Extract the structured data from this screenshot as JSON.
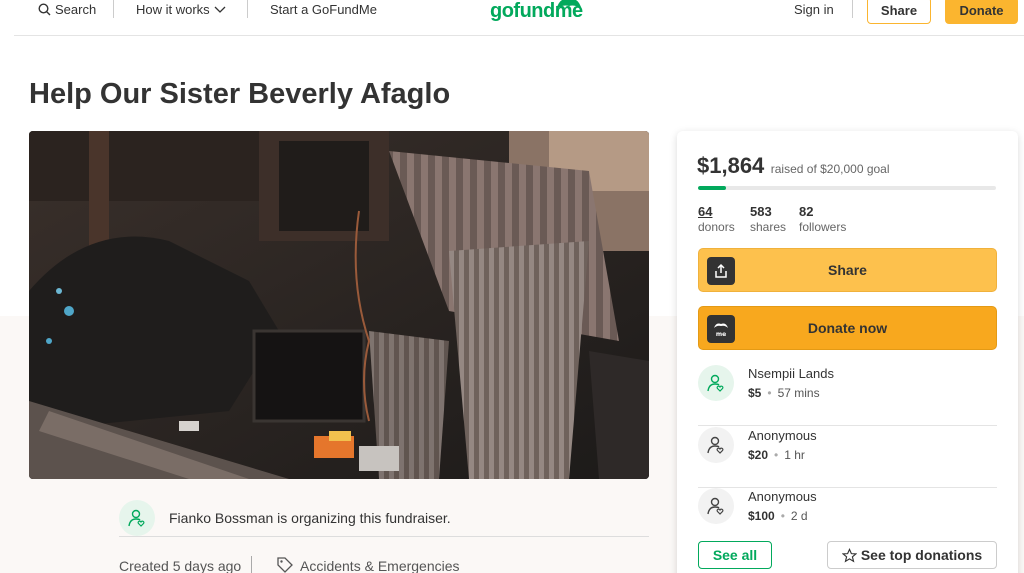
{
  "header": {
    "search_label": "Search",
    "how_it_works_label": "How it works",
    "start_label": "Start a GoFundMe",
    "logo_text": "gofundme",
    "sign_in_label": "Sign in",
    "share_label": "Share",
    "donate_label": "Donate"
  },
  "campaign": {
    "title": "Help Our Sister Beverly Afaglo",
    "organizer_text": "Fianko Bossman is organizing this fundraiser.",
    "created_text": "Created 5 days ago",
    "category": "Accidents & Emergencies"
  },
  "sidebar": {
    "raised_amount": "$1,864",
    "raised_goal_text": "raised of $20,000 goal",
    "progress_fraction": 0.0932,
    "stats": [
      {
        "value": "64",
        "label": "donors"
      },
      {
        "value": "583",
        "label": "shares"
      },
      {
        "value": "82",
        "label": "followers"
      }
    ],
    "share_button_label": "Share",
    "donate_button_label": "Donate now",
    "donations": [
      {
        "name": "Nsempii Lands",
        "amount": "$5",
        "time": "57 mins"
      },
      {
        "name": "Anonymous",
        "amount": "$20",
        "time": "1 hr"
      },
      {
        "name": "Anonymous",
        "amount": "$100",
        "time": "2 d"
      }
    ],
    "see_all_label": "See all",
    "see_top_label": "See top donations"
  },
  "colors": {
    "brand_green": "#02a95c",
    "accent_yellow": "#fbb52f",
    "donate_orange": "#f8a81e"
  }
}
